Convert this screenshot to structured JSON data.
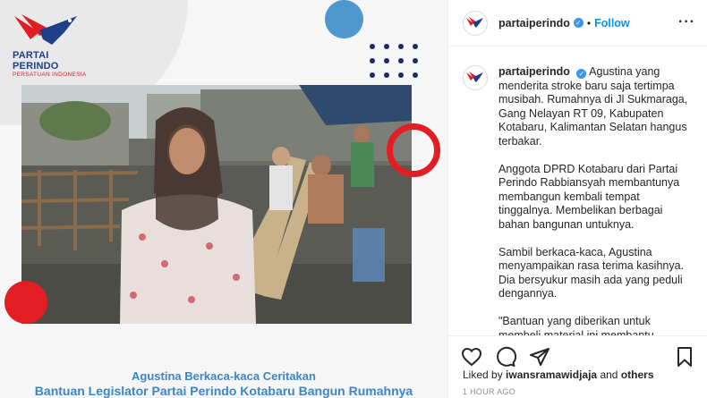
{
  "post_image": {
    "logo": {
      "name": "PARTAI PERINDO",
      "tagline": "PERSATUAN INDONESIA"
    },
    "caption_line1": "Agustina Berkaca-kaca Ceritakan",
    "caption_line2": "Bantuan Legislator Partai Perindo Kotabaru Bangun Rumahnya",
    "colors": {
      "brand_blue": "#1f3f8a",
      "brand_red": "#e21d24",
      "accent_blue": "#4f97cf"
    }
  },
  "header": {
    "handle": "partaiperindo",
    "separator": "•",
    "follow_label": "Follow",
    "more_label": "···"
  },
  "caption": {
    "handle": "partaiperindo",
    "first_text": "Agustina yang menderita stroke baru saja tertimpa musibah. Rumahnya di Jl Sukmaraga, Gang Nelayan RT 09, Kabupaten Kotabaru, Kalimantan Selatan hangus terbakar.",
    "para2": "Anggota DPRD Kotabaru dari Partai Perindo Rabbiansyah membantunya membangun kembali tempat tinggalnya. Membelikan berbagai bahan bangunan untuknya.",
    "para3": "Sambil berkaca-kaca, Agustina menyampaikan rasa terima kasihnya. Dia bersyukur masih ada yang peduli dengannya.",
    "para4": "\"Bantuan yang diberikan untuk membeli material ini membantu"
  },
  "actions": {
    "icons": [
      "heart-icon",
      "comment-icon",
      "share-icon",
      "bookmark-icon"
    ]
  },
  "likes": {
    "prefix": "Liked by",
    "user": "iwansramawidjaja",
    "middle": "and",
    "others": "others"
  },
  "timestamp": "1 HOUR AGO"
}
